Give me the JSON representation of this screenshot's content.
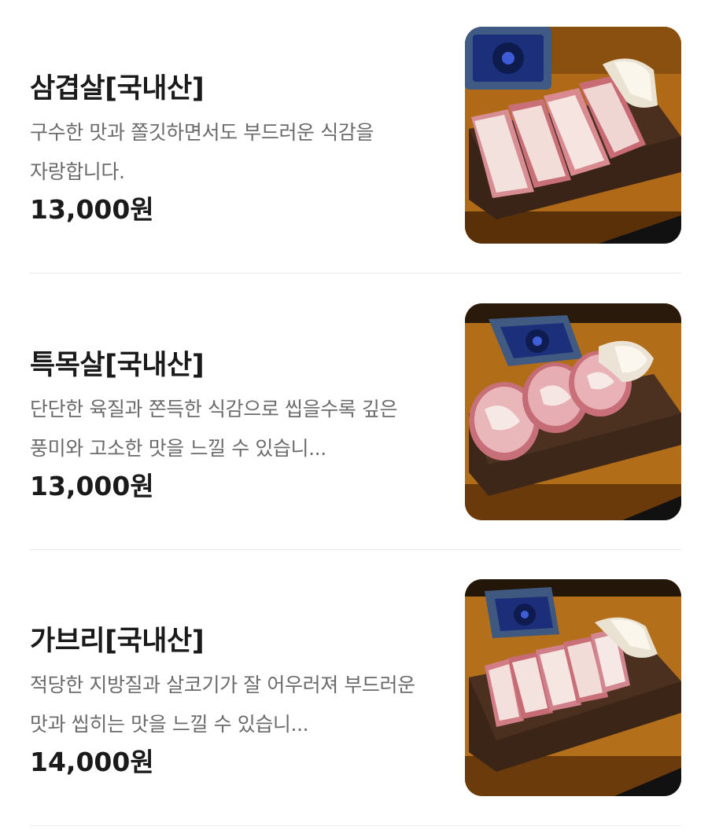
{
  "menu": {
    "items": [
      {
        "name": "삼겹살[국내산]",
        "description": "구수한 맛과 쫄깃하면서도 부드러운 식감을 자랑합니다.",
        "price": "13,000원",
        "photo_icon": "pork-belly-photo"
      },
      {
        "name": "특목살[국내산]",
        "description": "단단한 육질과 쫀득한 식감으로 씹을수록 깊은 풍미와 고소한 맛을 느낄 수 있습니...",
        "price": "13,000원",
        "photo_icon": "pork-neck-photo"
      },
      {
        "name": "가브리[국내산]",
        "description": "적당한 지방질과 살코기가 잘 어우러져 부드러운 맛과 씹히는 맛을 느낄 수 있습니...",
        "price": "14,000원",
        "photo_icon": "pork-jowl-photo"
      }
    ]
  },
  "colors": {
    "title": "#1a1a1a",
    "description": "#6b6b6b",
    "divider": "#e9e9e9",
    "table_wood": "#b36d18",
    "board": "#3a2418"
  }
}
